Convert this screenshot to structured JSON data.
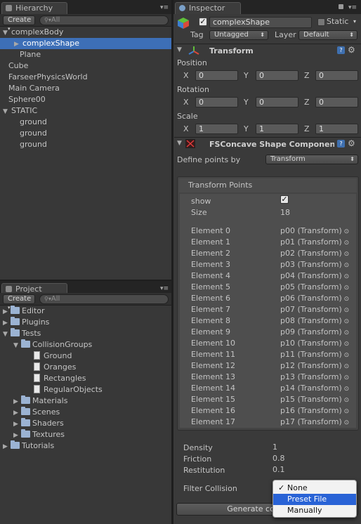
{
  "hierarchy": {
    "tab_label": "Hierarchy",
    "create_label": "Create",
    "search_placeholder": "All",
    "items": [
      {
        "label": "complexBody",
        "indent": 0,
        "arrow": "open"
      },
      {
        "label": "complexShape",
        "indent": 1,
        "arrow": "closed",
        "selected": true
      },
      {
        "label": "Plane",
        "indent": 1
      },
      {
        "label": "Cube",
        "indent": 0
      },
      {
        "label": "FarseerPhysicsWorld",
        "indent": 0
      },
      {
        "label": "Main Camera",
        "indent": 0
      },
      {
        "label": "Sphere00",
        "indent": 0
      },
      {
        "label": "STATIC",
        "indent": 0,
        "arrow": "open"
      },
      {
        "label": "ground",
        "indent": 1
      },
      {
        "label": "ground",
        "indent": 1
      },
      {
        "label": "ground",
        "indent": 1
      }
    ]
  },
  "project": {
    "tab_label": "Project",
    "create_label": "Create",
    "search_placeholder": "All",
    "items": [
      {
        "label": "Editor",
        "indent": 0,
        "arrow": "closed",
        "kind": "folder"
      },
      {
        "label": "Plugins",
        "indent": 0,
        "arrow": "closed",
        "kind": "folder"
      },
      {
        "label": "Tests",
        "indent": 0,
        "arrow": "open",
        "kind": "folder"
      },
      {
        "label": "CollisionGroups",
        "indent": 1,
        "arrow": "open",
        "kind": "folder"
      },
      {
        "label": "Ground",
        "indent": 2,
        "kind": "file"
      },
      {
        "label": "Oranges",
        "indent": 2,
        "kind": "file"
      },
      {
        "label": "Rectangles",
        "indent": 2,
        "kind": "file"
      },
      {
        "label": "RegularObjects",
        "indent": 2,
        "kind": "file"
      },
      {
        "label": "Materials",
        "indent": 1,
        "arrow": "closed",
        "kind": "folder"
      },
      {
        "label": "Scenes",
        "indent": 1,
        "arrow": "closed",
        "kind": "folder"
      },
      {
        "label": "Shaders",
        "indent": 1,
        "arrow": "closed",
        "kind": "folder"
      },
      {
        "label": "Textures",
        "indent": 1,
        "arrow": "closed",
        "kind": "folder"
      },
      {
        "label": "Tutorials",
        "indent": 0,
        "arrow": "closed",
        "kind": "folder"
      }
    ]
  },
  "inspector": {
    "tab_label": "Inspector",
    "object_name": "complexShape",
    "static_label": "Static",
    "tag_label": "Tag",
    "tag_value": "Untagged",
    "layer_label": "Layer",
    "layer_value": "Default",
    "transform": {
      "title": "Transform",
      "position_label": "Position",
      "rotation_label": "Rotation",
      "scale_label": "Scale",
      "x": "X",
      "y": "Y",
      "z": "Z",
      "position": [
        "0",
        "0",
        "0"
      ],
      "rotation": [
        "0",
        "0",
        "0"
      ],
      "scale": [
        "1",
        "1",
        "1"
      ]
    },
    "component": {
      "title": "FSConcave Shape Component (Sc",
      "define_label": "Define points by",
      "define_value": "Transform",
      "points_header": "Transform Points",
      "show_label": "show",
      "size_label": "Size",
      "size_value": "18",
      "elements": [
        {
          "label": "Element 0",
          "value": "p00 (Transform)"
        },
        {
          "label": "Element 1",
          "value": "p01 (Transform)"
        },
        {
          "label": "Element 2",
          "value": "p02 (Transform)"
        },
        {
          "label": "Element 3",
          "value": "p03 (Transform)"
        },
        {
          "label": "Element 4",
          "value": "p04 (Transform)"
        },
        {
          "label": "Element 5",
          "value": "p05 (Transform)"
        },
        {
          "label": "Element 6",
          "value": "p06 (Transform)"
        },
        {
          "label": "Element 7",
          "value": "p07 (Transform)"
        },
        {
          "label": "Element 8",
          "value": "p08 (Transform)"
        },
        {
          "label": "Element 9",
          "value": "p09 (Transform)"
        },
        {
          "label": "Element 10",
          "value": "p10 (Transform)"
        },
        {
          "label": "Element 11",
          "value": "p11 (Transform)"
        },
        {
          "label": "Element 12",
          "value": "p12 (Transform)"
        },
        {
          "label": "Element 13",
          "value": "p13 (Transform)"
        },
        {
          "label": "Element 14",
          "value": "p14 (Transform)"
        },
        {
          "label": "Element 15",
          "value": "p15 (Transform)"
        },
        {
          "label": "Element 16",
          "value": "p16 (Transform)"
        },
        {
          "label": "Element 17",
          "value": "p17 (Transform)"
        }
      ],
      "density_label": "Density",
      "density_value": "1",
      "friction_label": "Friction",
      "friction_value": "0.8",
      "restitution_label": "Restitution",
      "restitution_value": "0.1",
      "filter_label": "Filter Collision",
      "filter_options": [
        "None",
        "Preset File",
        "Manually"
      ],
      "filter_checked": "None",
      "filter_highlighted": "Preset File",
      "generate_label": "Generate con"
    }
  },
  "colors": {
    "selection": "#3d6fb7",
    "panel": "#383838",
    "popup_highlight": "#2963d6"
  }
}
